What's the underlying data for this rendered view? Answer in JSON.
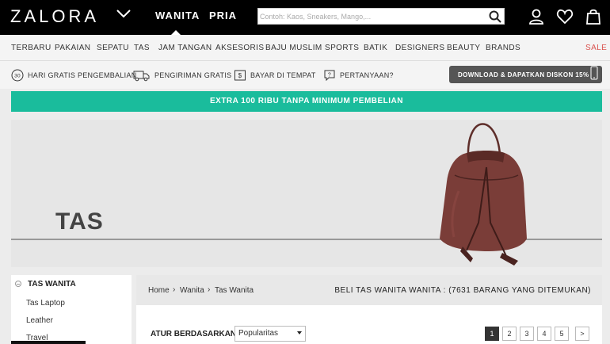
{
  "header": {
    "logo": "ZALORA",
    "gender_tabs": [
      "WANITA",
      "PRIA"
    ],
    "active_gender": "WANITA",
    "search_placeholder": "Contoh: Kaos, Sneakers, Mango,..."
  },
  "categories": [
    "TERBARU",
    "PAKAIAN",
    "SEPATU",
    "TAS",
    "JAM TANGAN",
    "AKSESORIS",
    "BAJU MUSLIM",
    "SPORTS",
    "BATIK",
    "DESIGNERS",
    "BEAUTY",
    "BRANDS",
    "SALE"
  ],
  "usp": {
    "returns": "HARI GRATIS PENGEMBALIAN",
    "returns_badge": "30",
    "shipping": "PENGIRIMAN GRATIS",
    "cod": "BAYAR DI TEMPAT",
    "questions": "PERTANYAAN?",
    "download": "DOWNLOAD & DAPATKAN DISKON 15%"
  },
  "promo": "EXTRA 100 RIBU TANPA MINIMUM PEMBELIAN",
  "banner": {
    "title": "TAS"
  },
  "sidebar": {
    "heading": "TAS WANITA",
    "items": [
      "Tas Laptop",
      "Leather",
      "Travel"
    ]
  },
  "breadcrumb": [
    "Home",
    "Wanita",
    "Tas Wanita"
  ],
  "result_text": "BELI TAS WANITA WANITA : (7631 BARANG YANG DITEMUKAN)",
  "sort": {
    "label": "ATUR BERDASARKAN",
    "value": "Popularitas"
  },
  "pagination": {
    "pages": [
      "1",
      "2",
      "3",
      "4",
      "5"
    ],
    "current": "1",
    "next": ">"
  },
  "colors": {
    "promo": "#1abc9c",
    "sale": "#d9534f",
    "topbar": "#000000"
  }
}
